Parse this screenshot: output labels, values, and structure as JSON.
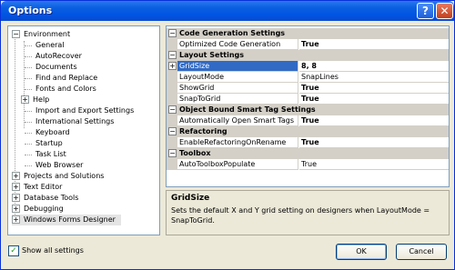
{
  "window": {
    "title": "Options",
    "help_glyph": "?",
    "close_glyph": "✕"
  },
  "tree": {
    "items": [
      {
        "label": "Environment",
        "expander": "−"
      },
      {
        "label": "General"
      },
      {
        "label": "AutoRecover"
      },
      {
        "label": "Documents"
      },
      {
        "label": "Find and Replace"
      },
      {
        "label": "Fonts and Colors"
      },
      {
        "label": "Help",
        "expander": "+"
      },
      {
        "label": "Import and Export Settings"
      },
      {
        "label": "International Settings"
      },
      {
        "label": "Keyboard"
      },
      {
        "label": "Startup"
      },
      {
        "label": "Task List"
      },
      {
        "label": "Web Browser"
      },
      {
        "label": "Projects and Solutions",
        "expander": "+"
      },
      {
        "label": "Text Editor",
        "expander": "+"
      },
      {
        "label": "Database Tools",
        "expander": "+"
      },
      {
        "label": "Debugging",
        "expander": "+"
      },
      {
        "label": "Windows Forms Designer",
        "expander": "+"
      }
    ]
  },
  "grid": {
    "categories": [
      {
        "label": "Code Generation Settings",
        "expander": "−"
      },
      {
        "label": "Layout Settings",
        "expander": "−"
      },
      {
        "label": "Object Bound Smart Tag Settings",
        "expander": "−"
      },
      {
        "label": "Refactoring",
        "expander": "−"
      },
      {
        "label": "Toolbox",
        "expander": "−"
      }
    ],
    "rows": [
      {
        "name": "Optimized Code Generation",
        "value": "True"
      },
      {
        "name": "GridSize",
        "value": "8, 8",
        "expander": "+"
      },
      {
        "name": "LayoutMode",
        "value": "SnapLines"
      },
      {
        "name": "ShowGrid",
        "value": "True"
      },
      {
        "name": "SnapToGrid",
        "value": "True"
      },
      {
        "name": "Automatically Open Smart Tags",
        "value": "True"
      },
      {
        "name": "EnableRefactoringOnRename",
        "value": "True"
      },
      {
        "name": "AutoToolboxPopulate",
        "value": "True"
      }
    ]
  },
  "description": {
    "title": "GridSize",
    "text": "Sets the default X and Y grid setting on designers when LayoutMode = SnapToGrid."
  },
  "footer": {
    "show_all_label": "Show all settings",
    "show_all_check": "✓",
    "ok_label": "OK",
    "cancel_label": "Cancel"
  }
}
